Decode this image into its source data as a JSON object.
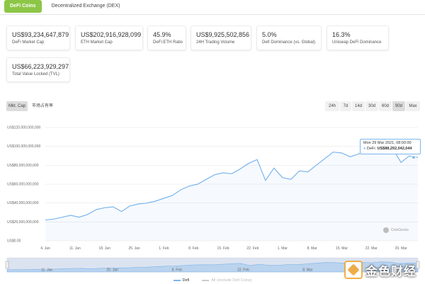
{
  "tabs": [
    {
      "label": "DeFi Coins",
      "active": true
    },
    {
      "label": "Decentralized Exchange (DEX)",
      "active": false
    }
  ],
  "stats": [
    {
      "value": "US$93,234,647,879",
      "label": "DeFi Market Cap"
    },
    {
      "value": "US$202,916,928,099",
      "label": "ETH Market Cap"
    },
    {
      "value": "45.9%",
      "label": "DeFi:ETH Ratio"
    },
    {
      "value": "US$9,925,502,856",
      "label": "24H Trading Volume"
    },
    {
      "value": "5.0%",
      "label": "Defi Dominance (vs. Global)"
    },
    {
      "value": "16.3%",
      "label": "Uniswap DeFi Dominance"
    },
    {
      "value": "US$66,223,929,297",
      "label": "Total Value Locked (TVL)"
    }
  ],
  "chart_tabs": [
    {
      "label": "Mkt. Cap",
      "selected": true
    },
    {
      "label": "市场占有率",
      "selected": false
    }
  ],
  "ranges": [
    {
      "label": "24h",
      "selected": false
    },
    {
      "label": "7d",
      "selected": false
    },
    {
      "label": "14d",
      "selected": false
    },
    {
      "label": "30d",
      "selected": false
    },
    {
      "label": "60d",
      "selected": false
    },
    {
      "label": "90d",
      "selected": true
    },
    {
      "label": "Max",
      "selected": false
    }
  ],
  "tooltip": {
    "date": "Mon 29 Mar 2021, 08:00:00",
    "series": "DeFi:",
    "value": "US$88,292,042,044"
  },
  "credit": "CoinGecko",
  "legend": [
    {
      "label": "Defi",
      "active": true
    },
    {
      "label": "All (exclude Defi Coins)",
      "active": false
    }
  ],
  "navigator_labels": [
    "11. Jan",
    "25. Jan",
    "8. Feb",
    "22. Feb",
    "8. Mar",
    "22. Mar"
  ],
  "watermark": "金色财经",
  "colors": {
    "accent": "#8dc647",
    "series": "#7cb5ec"
  },
  "chart_data": {
    "type": "area",
    "title": "",
    "xlabel": "",
    "ylabel": "",
    "x_tick_labels": [
      "4. Jan",
      "11. Jan",
      "18. Jan",
      "25. Jan",
      "1. Feb",
      "8. Feb",
      "15. Feb",
      "22. Feb",
      "1. Mar",
      "8. Mar",
      "15. Mar",
      "22. Mar",
      "29. Mar"
    ],
    "y_tick_labels": [
      "US$0.00",
      "US$20,000,000,000",
      "US$40,000,000,000",
      "US$60,000,000,000",
      "US$80,000,000,000",
      "US$100,000,000,000",
      "US$120,000,000,000"
    ],
    "ylim": [
      0,
      120000000000
    ],
    "xlim_days": [
      0,
      88
    ],
    "series": [
      {
        "name": "Defi",
        "x_days": [
          0,
          2,
          4,
          6,
          8,
          10,
          12,
          14,
          16,
          18,
          20,
          22,
          24,
          26,
          28,
          30,
          32,
          34,
          36,
          38,
          40,
          42,
          44,
          46,
          48,
          50,
          52,
          54,
          56,
          58,
          60,
          62,
          64,
          66,
          68,
          70,
          72,
          74,
          76,
          78,
          80,
          82,
          84,
          86,
          88
        ],
        "values_billion": [
          22,
          23,
          25,
          27,
          25,
          28,
          33,
          35,
          36,
          31,
          37,
          39,
          40,
          42,
          45,
          48,
          54,
          58,
          60,
          65,
          70,
          72,
          71,
          76,
          82,
          86,
          64,
          77,
          67,
          65,
          74,
          73,
          80,
          87,
          94,
          93,
          89,
          92,
          96,
          92,
          100,
          98,
          83,
          90,
          88.3
        ]
      }
    ],
    "grid": true,
    "legend_position": "bottom"
  }
}
